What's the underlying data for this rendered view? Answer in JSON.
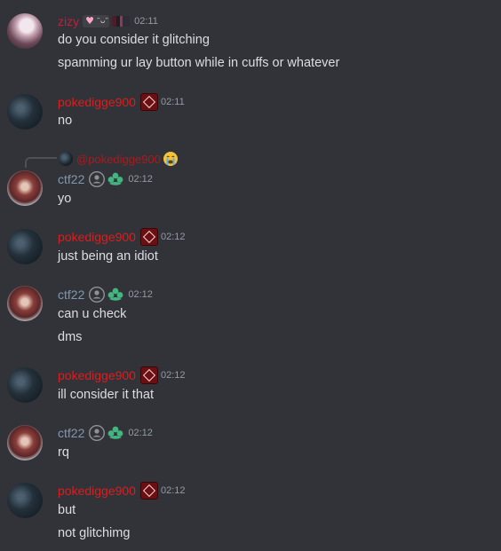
{
  "colors": {
    "background": "#313338",
    "text": "#dbdee1",
    "timestamp": "#949ba4",
    "zizy_name": "#c41e3a",
    "poke_name": "#dc1d1d",
    "ctf_name": "#7f98b2"
  },
  "messages": [
    {
      "author": "zizy",
      "time": "02:11",
      "lines": [
        "do you consider it glitching",
        "spamming ur lay button while in cuffs or whatever"
      ]
    },
    {
      "author": "pokedigge900",
      "time": "02:11",
      "lines": [
        "no"
      ]
    },
    {
      "reply_to": "@pokedigge900",
      "author": "ctf22",
      "time": "02:12",
      "lines": [
        "yo"
      ]
    },
    {
      "author": "pokedigge900",
      "time": "02:12",
      "lines": [
        "just being an idiot"
      ]
    },
    {
      "author": "ctf22",
      "time": "02:12",
      "lines": [
        "can u check",
        "dms"
      ]
    },
    {
      "author": "pokedigge900",
      "time": "02:12",
      "lines": [
        "ill consider it that"
      ]
    },
    {
      "author": "ctf22",
      "time": "02:12",
      "lines": [
        "rq"
      ]
    },
    {
      "author": "pokedigge900",
      "time": "02:12",
      "lines": [
        "but",
        "not glitchimg"
      ]
    }
  ]
}
